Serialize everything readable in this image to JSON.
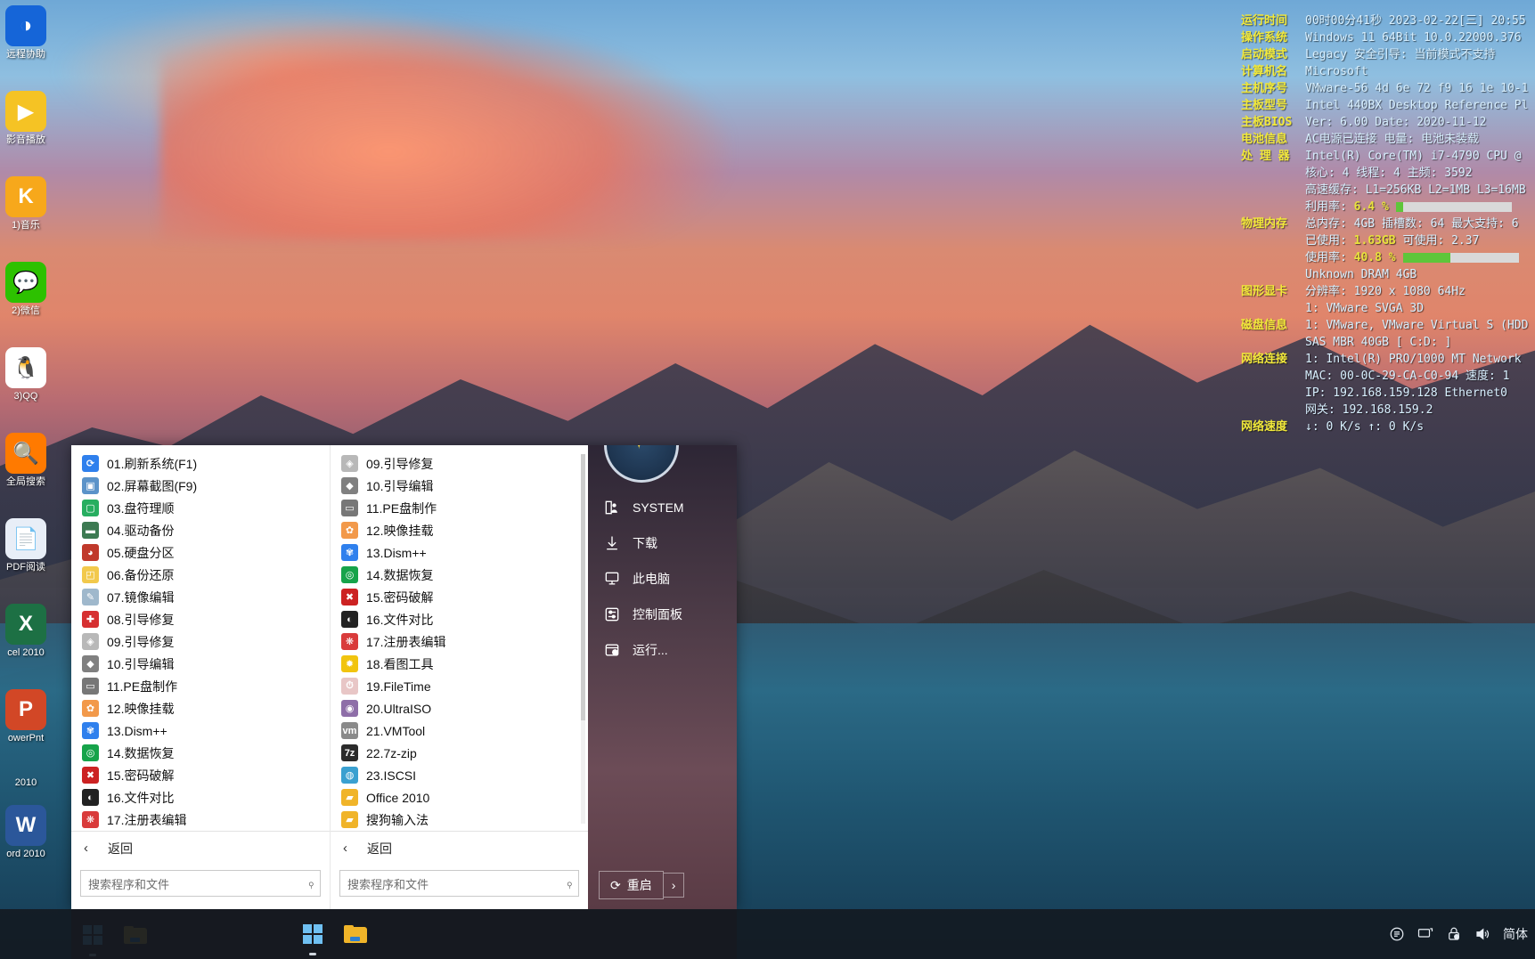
{
  "desktop": {
    "icons": [
      {
        "label": "远程协助",
        "icon": "remote-assist-icon",
        "bg": "#1565d8",
        "glyph": "◑"
      },
      {
        "label": "影音播放",
        "icon": "media-player-icon",
        "bg": "#f5c324",
        "glyph": "▶"
      },
      {
        "label": "1)音乐",
        "icon": "kugou-music-icon",
        "bg": "#f7a81b",
        "glyph": "K"
      },
      {
        "label": "2)微信",
        "icon": "wechat-icon",
        "bg": "#2dc100",
        "glyph": "💬"
      },
      {
        "label": "3)QQ",
        "icon": "qq-icon",
        "bg": "#ffffff",
        "glyph": "🐧"
      },
      {
        "label": "全局搜索",
        "icon": "global-search-icon",
        "bg": "#ff7a00",
        "glyph": "🔍"
      },
      {
        "label": "PDF阅读",
        "icon": "pdf-reader-icon",
        "bg": "#e8eef7",
        "glyph": "📄"
      },
      {
        "label": "cel 2010",
        "icon": "excel-2010-icon",
        "bg": "#1d7044",
        "glyph": "X"
      },
      {
        "label": "owerPnt",
        "icon": "powerpoint-2010-icon",
        "bg": "#d24726",
        "glyph": "P"
      },
      {
        "label": "2010",
        "icon": "powerpoint-2010-year",
        "bg": "transparent",
        "glyph": ""
      },
      {
        "label": "ord 2010",
        "icon": "word-2010-icon",
        "bg": "#2b579a",
        "glyph": "W"
      }
    ]
  },
  "sysinfo": {
    "rows": [
      {
        "label": "运行时间",
        "value": "00时00分41秒  2023-02-22[三]  20:55"
      },
      {
        "label": "操作系统",
        "value": "Windows 11 64Bit 10.0.22000.376"
      },
      {
        "label": "启动模式",
        "value": "Legacy      安全引导: 当前模式不支持"
      },
      {
        "label": "计算机名",
        "value": "Microsoft"
      },
      {
        "label": "主机序号",
        "value": "VMware-56 4d 6e 72 f9 16 1e 10-1"
      },
      {
        "label": "主板型号",
        "value": "Intel 440BX Desktop Reference Pl"
      },
      {
        "label": "主板BIOS",
        "value": "Ver: 6.00  Date: 2020-11-12"
      },
      {
        "label": "电池信息",
        "value": "AC电源已连接  电量: 电池未装载"
      },
      {
        "label": "处 理 器",
        "value": "Intel(R) Core(TM) i7-4790 CPU @"
      },
      {
        "label": "",
        "value": "核心: 4  线程: 4          主频: 3592"
      },
      {
        "label": "",
        "value": "高速缓存: L1=256KB L2=1MB L3=16MB"
      },
      {
        "label": "",
        "value": "利用率:  6.4 %",
        "hl": "6.4 %",
        "bar": 6
      },
      {
        "label": "物理内存",
        "value": "总内存: 4GB 插槽数: 64 最大支持: 6"
      },
      {
        "label": "",
        "value": "已使用: 1.63GB          可使用: 2.37",
        "hl": "1.63GB"
      },
      {
        "label": "",
        "value": "使用率: 40.8 %",
        "hl": "40.8 %",
        "bar": 41
      },
      {
        "label": "",
        "value": "Unknown DRAM 4GB"
      },
      {
        "label": "图形显卡",
        "value": "分辨率: 1920 x 1080 64Hz"
      },
      {
        "label": "",
        "value": "1: VMware SVGA 3D"
      },
      {
        "label": "磁盘信息",
        "value": "1: VMware, VMware Virtual S (HDD"
      },
      {
        "label": "",
        "value": "   SAS MBR 40GB [ C:D: ]"
      },
      {
        "label": "网络连接",
        "value": "1: Intel(R) PRO/1000 MT Network"
      },
      {
        "label": "",
        "value": "   MAC: 00-0C-29-CA-C0-94 速度: 1"
      },
      {
        "label": "",
        "value": "   IP: 192.168.159.128 Ethernet0"
      },
      {
        "label": "",
        "value": "   网关: 192.168.159.2"
      },
      {
        "label": "网络速度",
        "value": "↓: 0 K/s          ↑: 0 K/s"
      }
    ]
  },
  "startmenu": {
    "column1": [
      {
        "label": "01.刷新系统(F1)",
        "icon": "refresh-icon",
        "bg": "#2f80ed",
        "glyph": "⟳"
      },
      {
        "label": "02.屏幕截图(F9)",
        "icon": "screenshot-icon",
        "bg": "#5b93c9",
        "glyph": "▣"
      },
      {
        "label": "03.盘符理顺",
        "icon": "drive-letter-icon",
        "bg": "#27ae60",
        "glyph": "▢"
      },
      {
        "label": "04.驱动备份",
        "icon": "driver-backup-icon",
        "bg": "#3d7a52",
        "glyph": "▬"
      },
      {
        "label": "05.硬盘分区",
        "icon": "disk-partition-icon",
        "bg": "#c0392b",
        "glyph": "◕"
      },
      {
        "label": "06.备份还原",
        "icon": "backup-restore-icon",
        "bg": "#f2c94c",
        "glyph": "◰"
      },
      {
        "label": "07.镜像编辑",
        "icon": "image-edit-icon",
        "bg": "#9fb8cc",
        "glyph": "✎"
      },
      {
        "label": "08.引导修复",
        "icon": "boot-repair-icon",
        "bg": "#d63031",
        "glyph": "✚"
      },
      {
        "label": "09.引导修复",
        "icon": "boot-repair-2-icon",
        "bg": "#b8b8b8",
        "glyph": "◈"
      },
      {
        "label": "10.引导编辑",
        "icon": "boot-edit-icon",
        "bg": "#808080",
        "glyph": "◆"
      },
      {
        "label": "11.PE盘制作",
        "icon": "pe-disk-maker-icon",
        "bg": "#777777",
        "glyph": "▭"
      },
      {
        "label": "12.映像挂载",
        "icon": "image-mount-icon",
        "bg": "#f2994a",
        "glyph": "✿"
      },
      {
        "label": "13.Dism++",
        "icon": "dism-icon",
        "bg": "#2f80ed",
        "glyph": "✾"
      },
      {
        "label": "14.数据恢复",
        "icon": "data-recovery-icon",
        "bg": "#16a34a",
        "glyph": "◎"
      },
      {
        "label": "15.密码破解",
        "icon": "password-crack-icon",
        "bg": "#cc2222",
        "glyph": "✖"
      },
      {
        "label": "16.文件对比",
        "icon": "file-compare-icon",
        "bg": "#222222",
        "glyph": "◐"
      },
      {
        "label": "17.注册表编辑",
        "icon": "registry-edit-icon",
        "bg": "#d93b3b",
        "glyph": "❋"
      }
    ],
    "column2": [
      {
        "label": "09.引导修复",
        "icon": "boot-repair-2-icon",
        "bg": "#b8b8b8",
        "glyph": "◈"
      },
      {
        "label": "10.引导编辑",
        "icon": "boot-edit-icon",
        "bg": "#808080",
        "glyph": "◆"
      },
      {
        "label": "11.PE盘制作",
        "icon": "pe-disk-maker-icon",
        "bg": "#777777",
        "glyph": "▭"
      },
      {
        "label": "12.映像挂载",
        "icon": "image-mount-icon",
        "bg": "#f2994a",
        "glyph": "✿"
      },
      {
        "label": "13.Dism++",
        "icon": "dism-icon",
        "bg": "#2f80ed",
        "glyph": "✾"
      },
      {
        "label": "14.数据恢复",
        "icon": "data-recovery-icon",
        "bg": "#16a34a",
        "glyph": "◎"
      },
      {
        "label": "15.密码破解",
        "icon": "password-crack-icon",
        "bg": "#cc2222",
        "glyph": "✖"
      },
      {
        "label": "16.文件对比",
        "icon": "file-compare-icon",
        "bg": "#222222",
        "glyph": "◐"
      },
      {
        "label": "17.注册表编辑",
        "icon": "registry-edit-icon",
        "bg": "#d93b3b",
        "glyph": "❋"
      },
      {
        "label": "18.看图工具",
        "icon": "image-viewer-icon",
        "bg": "#f1c40f",
        "glyph": "✹"
      },
      {
        "label": "19.FileTime",
        "icon": "filetime-icon",
        "bg": "#e8c6c6",
        "glyph": "⏱"
      },
      {
        "label": "20.UltraISO",
        "icon": "ultraiso-icon",
        "bg": "#8e6ea8",
        "glyph": "◉"
      },
      {
        "label": "21.VMTool",
        "icon": "vmtool-icon",
        "bg": "#8a8a8a",
        "glyph": "vm"
      },
      {
        "label": "22.7z-zip",
        "icon": "sevenzip-icon",
        "bg": "#2b2b2b",
        "glyph": "7z"
      },
      {
        "label": "23.ISCSI",
        "icon": "iscsi-icon",
        "bg": "#3aa0d0",
        "glyph": "◍"
      },
      {
        "label": "Office 2010",
        "icon": "folder-icon",
        "bg": "#f0b429",
        "glyph": "▰"
      },
      {
        "label": "搜狗输入法",
        "icon": "folder-icon",
        "bg": "#f0b429",
        "glyph": "▰"
      }
    ],
    "back_label": "返回",
    "search_placeholder": "搜索程序和文件",
    "right_items": [
      {
        "label": "SYSTEM",
        "icon": "user-system-icon"
      },
      {
        "label": "下载",
        "icon": "download-icon"
      },
      {
        "label": "此电脑",
        "icon": "this-pc-icon"
      },
      {
        "label": "控制面板",
        "icon": "control-panel-icon"
      },
      {
        "label": "运行...",
        "icon": "run-icon"
      }
    ],
    "power": {
      "label": "重启",
      "icon": "restart-icon",
      "arrow": "›"
    }
  },
  "taskbar": {
    "inner_buttons": [
      {
        "icon": "windows-start-icon",
        "name": "start-button"
      },
      {
        "icon": "file-explorer-icon",
        "name": "file-explorer-button"
      }
    ],
    "main_buttons": [
      {
        "icon": "windows-start-icon",
        "name": "start-button"
      },
      {
        "icon": "file-explorer-icon",
        "name": "file-explorer-button"
      }
    ],
    "tray": [
      {
        "icon": "notifications-icon"
      },
      {
        "icon": "display-icon"
      },
      {
        "icon": "security-icon"
      },
      {
        "icon": "volume-icon"
      },
      {
        "icon": "ime-icon",
        "label": "简体"
      }
    ]
  },
  "colors": {
    "accent_yellow": "#f2e93a",
    "accent_green": "#5ec63a",
    "menu_bg": "#ffffff",
    "taskbar_bg": "#341612"
  }
}
